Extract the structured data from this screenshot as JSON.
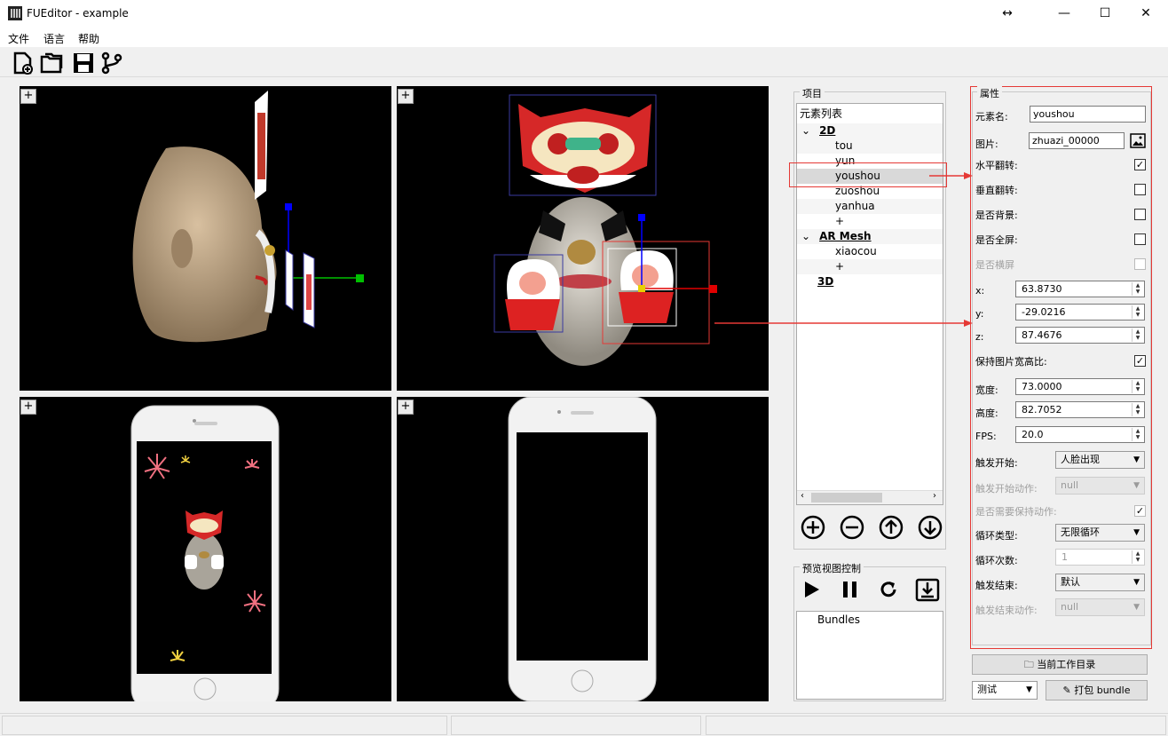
{
  "window": {
    "title": "FUEditor - example",
    "resize_glyph": "↔",
    "min_glyph": "—",
    "max_glyph": "☐",
    "close_glyph": "✕"
  },
  "menu": {
    "items": [
      "文件",
      "语言",
      "帮助"
    ]
  },
  "toolbar": {
    "icons": [
      "new-file-icon",
      "open-folder-icon",
      "save-icon",
      "branch-icon"
    ]
  },
  "viewports": {
    "plus_label": "+"
  },
  "project": {
    "legend": "项目",
    "tree": {
      "root": "元素列表",
      "group_2d": "2D",
      "items_2d": [
        "tou",
        "yun",
        "youshou",
        "zuoshou",
        "yanhua",
        "+"
      ],
      "group_ar": "AR Mesh",
      "items_ar": [
        "xiaocou",
        "+"
      ],
      "group_3d": "3D",
      "selected": "youshou"
    },
    "buttons": [
      "add-circle-icon",
      "remove-circle-icon",
      "move-up-icon",
      "move-down-icon"
    ]
  },
  "preview": {
    "legend": "预览视图控制",
    "bundles_label": "Bundles"
  },
  "properties": {
    "legend": "属性",
    "element_name_label": "元素名:",
    "element_name_value": "youshou",
    "image_label": "图片:",
    "image_value": "zhuazi_00000",
    "hflip_label": "水平翻转:",
    "vflip_label": "垂直翻转:",
    "bg_label": "是否背景:",
    "fullscreen_label": "是否全屏:",
    "landscape_label": "是否横屏",
    "x_label": "x:",
    "x_value": "63.8730",
    "y_label": "y:",
    "y_value": "-29.0216",
    "z_label": "z:",
    "z_value": "87.4676",
    "keep_ratio_label": "保持图片宽高比:",
    "width_label": "宽度:",
    "width_value": "73.0000",
    "height_label": "高度:",
    "height_value": "82.7052",
    "fps_label": "FPS:",
    "fps_value": "20.0",
    "trigger_start_label": "触发开始:",
    "trigger_start_value": "人脸出现",
    "trigger_start_action_label": "触发开始动作:",
    "trigger_start_action_value": "null",
    "keep_action_label": "是否需要保持动作:",
    "loop_type_label": "循环类型:",
    "loop_type_value": "无限循环",
    "loop_count_label": "循环次数:",
    "loop_count_value": "1",
    "trigger_end_label": "触发结束:",
    "trigger_end_value": "默认",
    "trigger_end_action_label": "触发结束动作:",
    "trigger_end_action_value": "null",
    "checks": {
      "hflip": true,
      "vflip": false,
      "bg": false,
      "fullscreen": false,
      "landscape": false,
      "keep_ratio": true,
      "keep_action": true
    }
  },
  "bottom": {
    "workdir_button": "当前工作目录",
    "mode_value": "测试",
    "pack_button": "打包 bundle"
  },
  "colors": {
    "annotation_red": "#e53935",
    "gizmo_blue": "#0000ff",
    "gizmo_green": "#00c000",
    "gizmo_red": "#e00000"
  }
}
